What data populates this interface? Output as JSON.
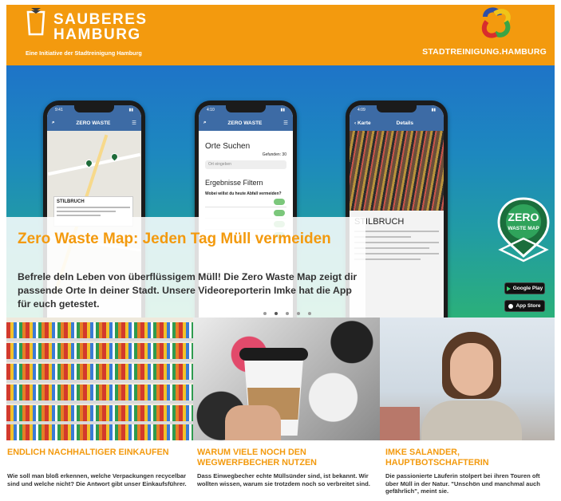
{
  "header": {
    "logo_title_line1": "SAUBERES",
    "logo_title_line2": "HAMBURG",
    "logo_tagline": "Eine Initiative der Stadtreinigung Hamburg",
    "brand": "STADTREINIGUNG.HAMBURG",
    "colors": {
      "orange": "#f39a0e"
    }
  },
  "hero": {
    "title": "Zero Waste Map: Jeden Tag Müll vermeiden",
    "text": "Befrele deln Leben von überflüssigem Müll! Die Zero Waste Map zeigt dir passende Orte In deiner Stadt. Unsere Videoreporterin Imke hat die App für euch getestet.",
    "carousel_dots": 5,
    "active_dot": 2,
    "phones": {
      "map_app_title": "ZERO WASTE",
      "map_card_title": "STILBRUCH",
      "search_title": "Orte Suchen",
      "search_found": "Gefunden: 30",
      "search_placeholder": "Ort eingeben",
      "filter_title": "Ergebnisse Filtern",
      "filter_question": "Wobei willst du heute Abfall vermeiden?",
      "detail_back": "Karte",
      "detail_header": "Details",
      "detail_name": "STILBRUCH"
    },
    "badge_line1": "ZERO",
    "badge_line2": "WASTE MAP",
    "google_play": "Google Play",
    "app_store": "App Store"
  },
  "cards": [
    {
      "title": "ENDLICH NACHHALTIGER EINKAUFEN",
      "text": "Wie soll man bloß erkennen, welche Verpackungen recycelbar sind und welche nicht? Die Antwort gibt unser Einkaufsführer."
    },
    {
      "title": "WARUM VIELE NOCH DEN WEGWERFBECHER NUTZEN",
      "text": "Dass Einwegbecher echte Müllsünder sind, ist bekannt. Wir wollten wissen, warum sie trotzdem noch so verbreitet sind."
    },
    {
      "title": "IMKE SALANDER, HAUPTBOTSCHAFTERIN",
      "text": "Die passionierte Läuferin stolpert bei ihren Touren oft über Müll in der Natur. \"Unschön und manchmal auch gefährlich\", meint sie."
    }
  ]
}
